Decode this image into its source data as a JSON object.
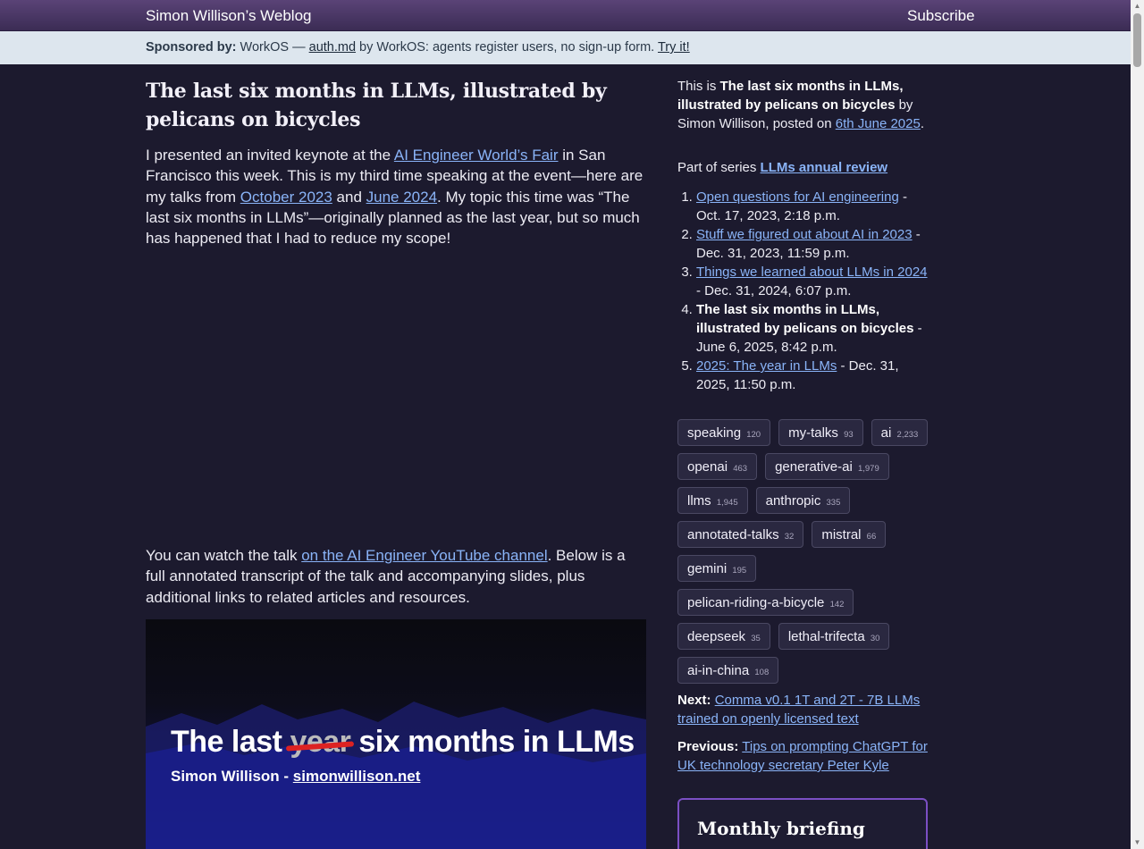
{
  "header": {
    "site_title": "Simon Willison’s Weblog",
    "subscribe": "Subscribe"
  },
  "sponsor": {
    "label": "Sponsored by:",
    "text_before": " WorkOS — ",
    "link": "auth.md",
    "text_after": " by WorkOS: agents register users, no sign-up form. ",
    "cta": "Try it!"
  },
  "article": {
    "title": "The last six months in LLMs, illustrated by pelicans on bicycles",
    "p1_a": "I presented an invited keynote at the ",
    "p1_link1": "AI Engineer World’s Fair",
    "p1_b": " in San Francisco this week. This is my third time speaking at the event—here are my talks from ",
    "p1_link2": "October 2023",
    "p1_c": " and ",
    "p1_link3": "June 2024",
    "p1_d": ". My topic this time was “The last six months in LLMs”—originally planned as the last year, but so much has happened that I had to reduce my scope!",
    "p2_a": "You can watch the talk ",
    "p2_link": "on the AI Engineer YouTube channel",
    "p2_b": ". Below is a full annotated transcript of the talk and accompanying slides, plus additional links to related articles and resources.",
    "slide": {
      "title_a": "The last ",
      "title_strike": "year",
      "title_b": " six months in LLMs",
      "subtitle_a": "Simon Willison - ",
      "subtitle_link": "simonwillison.net"
    }
  },
  "sidebar": {
    "intro_a": "This is ",
    "intro_title": "The last six months in LLMs, illustrated by pelicans on bicycles",
    "intro_b": " by Simon Willison, posted on ",
    "intro_date": "6th June 2025",
    "intro_c": ".",
    "series_label": "Part of series ",
    "series_name": "LLMs annual review",
    "series": [
      {
        "title": "Open questions for AI engineering",
        "date": " - Oct. 17, 2023, 2:18 p.m.",
        "current": false
      },
      {
        "title": "Stuff we figured out about AI in 2023",
        "date": " - Dec. 31, 2023, 11:59 p.m.",
        "current": false
      },
      {
        "title": "Things we learned about LLMs in 2024",
        "date": " - Dec. 31, 2024, 6:07 p.m.",
        "current": false
      },
      {
        "title": "The last six months in LLMs, illustrated by pelicans on bicycles",
        "date": " - June 6, 2025, 8:42 p.m.",
        "current": true
      },
      {
        "title": "2025: The year in LLMs",
        "date": " - Dec. 31, 2025, 11:50 p.m.",
        "current": false
      }
    ],
    "tags": [
      {
        "name": "speaking",
        "count": "120"
      },
      {
        "name": "my-talks",
        "count": "93"
      },
      {
        "name": "ai",
        "count": "2,233"
      },
      {
        "name": "openai",
        "count": "463"
      },
      {
        "name": "generative-ai",
        "count": "1,979"
      },
      {
        "name": "llms",
        "count": "1,945"
      },
      {
        "name": "anthropic",
        "count": "335"
      },
      {
        "name": "annotated-talks",
        "count": "32"
      },
      {
        "name": "mistral",
        "count": "66"
      },
      {
        "name": "gemini",
        "count": "195"
      },
      {
        "name": "pelican-riding-a-bicycle",
        "count": "142"
      },
      {
        "name": "deepseek",
        "count": "35"
      },
      {
        "name": "lethal-trifecta",
        "count": "30"
      },
      {
        "name": "ai-in-china",
        "count": "108"
      }
    ],
    "next_label": "Next:",
    "next_link": "Comma v0.1 1T and 2T - 7B LLMs trained on openly licensed text",
    "prev_label": "Previous:",
    "prev_link": "Tips on prompting ChatGPT for UK technology secretary Peter Kyle",
    "briefing_title": "Monthly briefing"
  },
  "colors": {
    "background": "#1c1a2e",
    "link": "#8ab4f8",
    "header": "#4a3766",
    "sponsor_bg": "#dde6ee",
    "briefing_border": "#7b4fc4"
  }
}
